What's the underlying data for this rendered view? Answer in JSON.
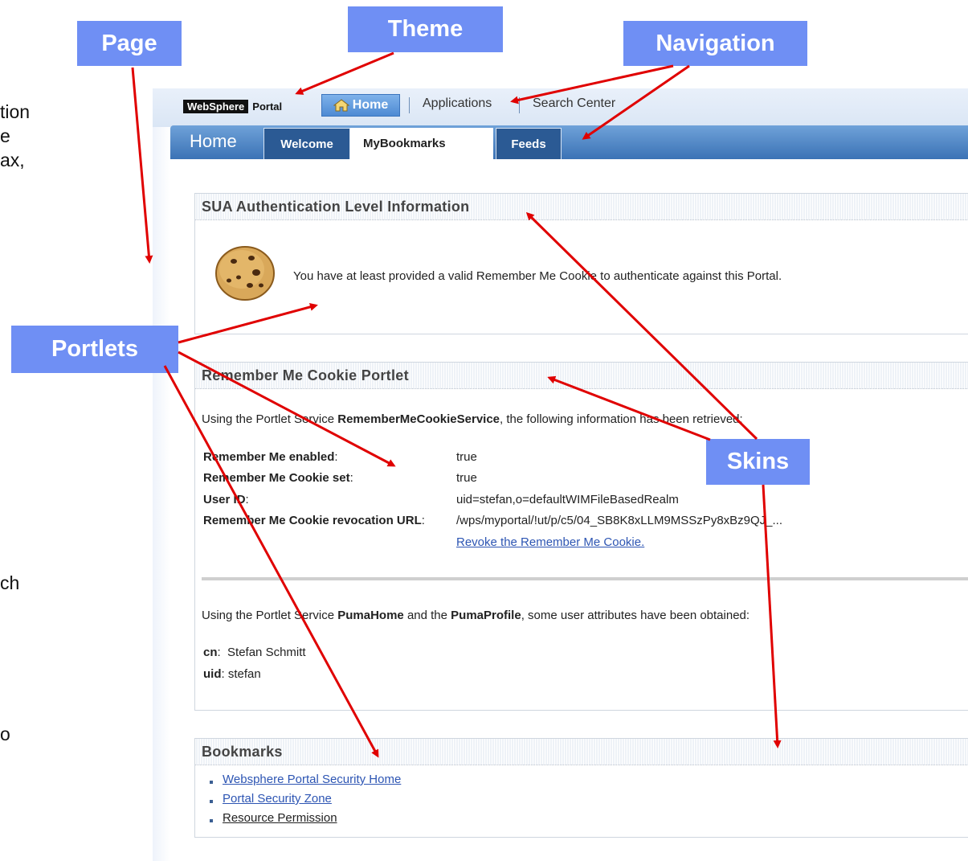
{
  "callouts": {
    "page": "Page",
    "theme": "Theme",
    "navigation": "Navigation",
    "portlets": "Portlets",
    "skins": "Skins"
  },
  "left_fragments": [
    "tion",
    "e",
    "ax,",
    "ch",
    "o"
  ],
  "header": {
    "logo_black": "WebSphere",
    "logo_text": "Portal",
    "nav": [
      "Home",
      "Applications",
      "Search Center"
    ]
  },
  "tabs": {
    "title": "Home",
    "items": [
      "Welcome",
      "MyBookmarks",
      "Feeds"
    ],
    "active": "MyBookmarks"
  },
  "sua": {
    "title": "SUA Authentication Level Information",
    "message": "You have at least provided a valid Remember Me Cookie to authenticate against this Portal."
  },
  "remember": {
    "title": "Remember Me Cookie Portlet",
    "intro_prefix": "Using the Portlet Service ",
    "intro_service": "RememberMeCookieService",
    "intro_suffix": ", the following information has been retrieved:",
    "rows": [
      {
        "label": "Remember Me enabled",
        "value": "true"
      },
      {
        "label": "Remember Me Cookie set",
        "value": "true"
      },
      {
        "label": "User ID",
        "value": "uid=stefan,o=defaultWIMFileBasedRealm"
      },
      {
        "label": "Remember Me Cookie revocation URL",
        "value": "/wps/myportal/!ut/p/c5/04_SB8K8xLLM9MSSzPy8xBz9QJ_..."
      }
    ],
    "revoke_link": "Revoke the Remember Me Cookie.",
    "puma_prefix": "Using the Portlet Service ",
    "puma_home": "PumaHome",
    "puma_mid": " and the ",
    "puma_profile": "PumaProfile",
    "puma_suffix": ", some user attributes have been obtained:",
    "attrs": [
      {
        "label": "cn",
        "value": "Stefan Schmitt"
      },
      {
        "label": "uid",
        "value": "stefan"
      }
    ]
  },
  "bookmarks": {
    "title": "Bookmarks",
    "items": [
      "Websphere Portal Security Home",
      "Portal Security Zone",
      "Resource Permission"
    ]
  },
  "colors": {
    "callout": "#6f8ff4",
    "arrow": "#e00000",
    "tab_dark": "#2b5a94",
    "link": "#2d55b3"
  }
}
